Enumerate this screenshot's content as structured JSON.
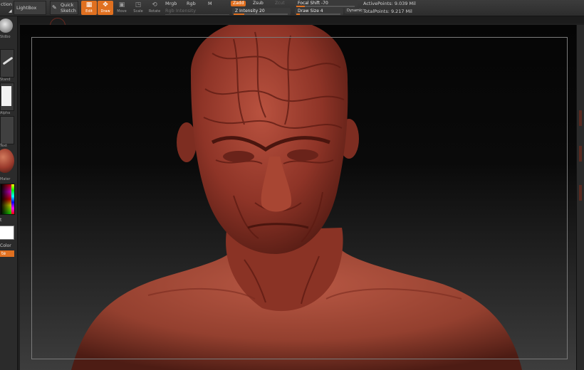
{
  "top_left_menu": {
    "label": "ction"
  },
  "lightbox": {
    "label": "LightBox"
  },
  "quick_sketch": {
    "line1": "Quick",
    "line2": "Sketch"
  },
  "modes": [
    {
      "label": "Edit",
      "icon": "edit-icon",
      "active": true
    },
    {
      "label": "Draw",
      "icon": "draw-icon",
      "active": true
    },
    {
      "label": "Move",
      "icon": "move-icon",
      "active": false
    },
    {
      "label": "Scale",
      "icon": "scale-icon",
      "active": false
    },
    {
      "label": "Rotate",
      "icon": "rotate-icon",
      "active": false
    }
  ],
  "material": {
    "mrgb": "Mrgb",
    "rgb": "Rgb",
    "m": "M",
    "rgb_intensity": "Rgb Intensity"
  },
  "zmode": {
    "zadd": "Zadd",
    "zsub": "Zsub",
    "zcut": "Zcut",
    "z_intensity": "Z Intensity 20",
    "z_intensity_value": 20
  },
  "brush": {
    "focal_shift": "Focal Shift -70",
    "focal_shift_value": -70,
    "draw_size": "Draw Size 4",
    "draw_size_value": 4,
    "dynamic": "Dynamic"
  },
  "stats": {
    "active_points": "ActivePoints: 9.039 Mil",
    "total_points": "TotalPoints: 9.217 Mil"
  },
  "left_tray": {
    "captions": [
      "Stdbo",
      "Stand",
      "Alpha",
      "Text",
      "Mater"
    ],
    "color_label": "Color",
    "texture_label": "t",
    "orange_button": "te"
  },
  "colors": {
    "accent": "#e07020",
    "sculpt": "#9a3a2c"
  }
}
